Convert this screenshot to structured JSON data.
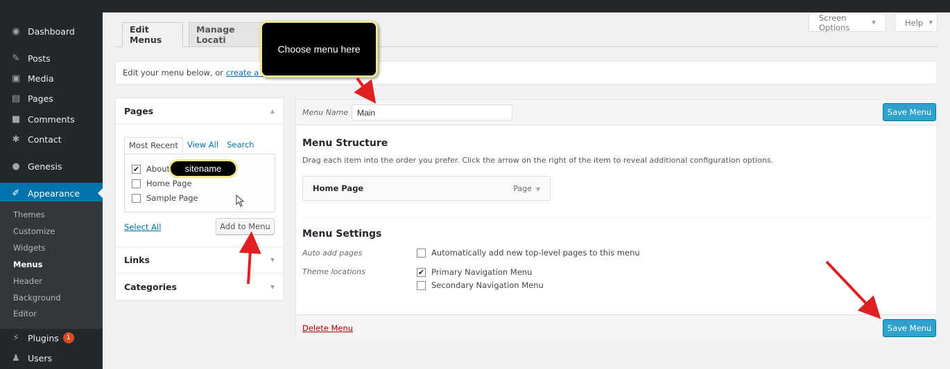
{
  "sidebar": {
    "items": [
      {
        "label": "Dashboard",
        "icon": "dashboard-icon"
      },
      {
        "label": "Posts",
        "icon": "pin-icon"
      },
      {
        "label": "Media",
        "icon": "media-icon"
      },
      {
        "label": "Pages",
        "icon": "pages-icon"
      },
      {
        "label": "Comments",
        "icon": "comment-icon"
      },
      {
        "label": "Contact",
        "icon": "gear-icon"
      },
      {
        "label": "Genesis",
        "icon": "genesis-icon"
      },
      {
        "label": "Appearance",
        "icon": "brush-icon"
      },
      {
        "label": "Plugins",
        "icon": "plug-icon"
      },
      {
        "label": "Users",
        "icon": "user-icon"
      }
    ],
    "submenu": [
      "Themes",
      "Customize",
      "Widgets",
      "Menus",
      "Header",
      "Background",
      "Editor"
    ],
    "plugins_badge": "1"
  },
  "screen_options": {
    "screen_options_label": "Screen Options",
    "help_label": "Help"
  },
  "tabs": {
    "edit_menus": "Edit Menus",
    "manage_locations": "Manage Locati"
  },
  "notice": {
    "text": "Edit your menu below, or",
    "link": "create a new"
  },
  "left_panel": {
    "pages_title": "Pages",
    "tab_most_recent": "Most Recent",
    "tab_view_all": "View All",
    "tab_search": "Search",
    "pages": [
      {
        "label": "About",
        "checked": true
      },
      {
        "label": "Home Page",
        "checked": false
      },
      {
        "label": "Sample Page",
        "checked": false
      }
    ],
    "select_all": "Select All",
    "add_to_menu": "Add to Menu",
    "links_title": "Links",
    "categories_title": "Categories"
  },
  "menu_editor": {
    "name_label": "Menu Name",
    "name_value": "Main",
    "save_label": "Save Menu",
    "structure_title": "Menu Structure",
    "structure_desc": "Drag each item into the order you prefer. Click the arrow on the right of the item to reveal additional configuration options.",
    "items": [
      {
        "title": "Home Page",
        "type": "Page"
      }
    ],
    "settings_title": "Menu Settings",
    "auto_add_label": "Auto add pages",
    "auto_add_option": "Automatically add new top-level pages to this menu",
    "auto_add_checked": false,
    "theme_locations_label": "Theme locations",
    "locations": [
      {
        "label": "Primary Navigation Menu",
        "checked": true
      },
      {
        "label": "Secondary Navigation Menu",
        "checked": false
      }
    ],
    "delete_label": "Delete Menu"
  },
  "annotations": {
    "callout_text": "Choose menu here",
    "pill_text": "sitename"
  },
  "colors": {
    "accent": "#0073aa",
    "save_button": "#2ea2cc",
    "arrow": "#e02020",
    "callout_border": "#f0e88a"
  }
}
